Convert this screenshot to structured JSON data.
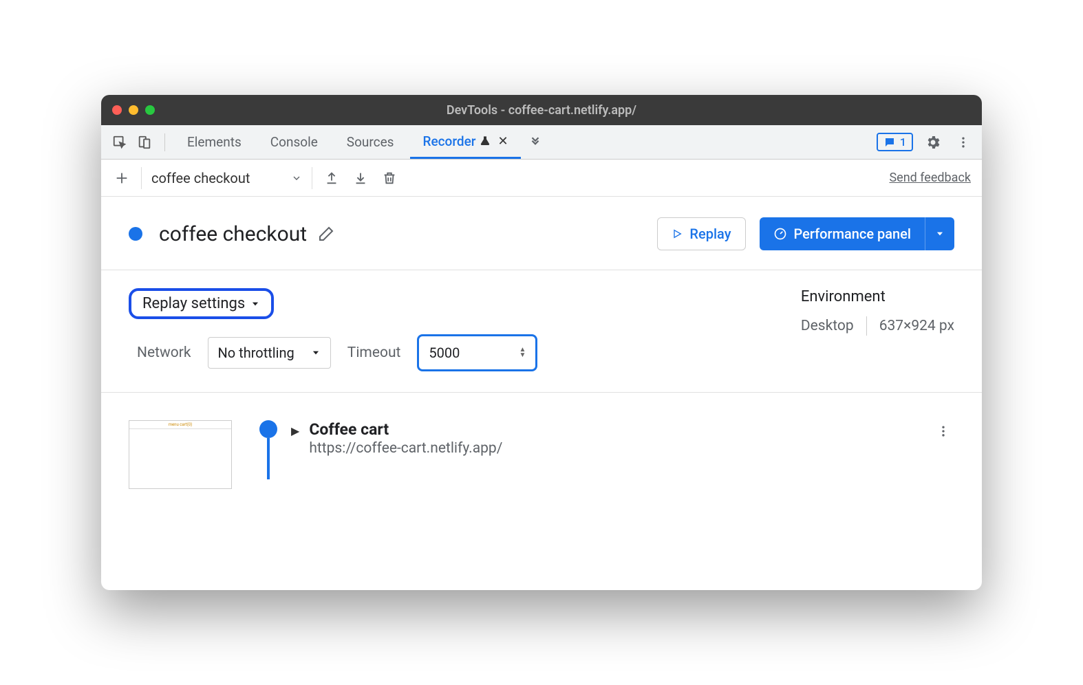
{
  "window": {
    "title": "DevTools - coffee-cart.netlify.app/"
  },
  "tabs": {
    "items": [
      "Elements",
      "Console",
      "Sources",
      "Recorder"
    ],
    "active": "Recorder",
    "messages_count": "1"
  },
  "toolbar": {
    "recording_name": "coffee checkout",
    "send_feedback": "Send feedback"
  },
  "header": {
    "title": "coffee checkout",
    "replay_label": "Replay",
    "perf_label": "Performance panel"
  },
  "settings": {
    "replay_settings_label": "Replay settings",
    "network_label": "Network",
    "network_value": "No throttling",
    "timeout_label": "Timeout",
    "timeout_value": "5000",
    "env_title": "Environment",
    "env_device": "Desktop",
    "env_dimensions": "637×924 px"
  },
  "step": {
    "title": "Coffee cart",
    "url": "https://coffee-cart.netlify.app/"
  }
}
